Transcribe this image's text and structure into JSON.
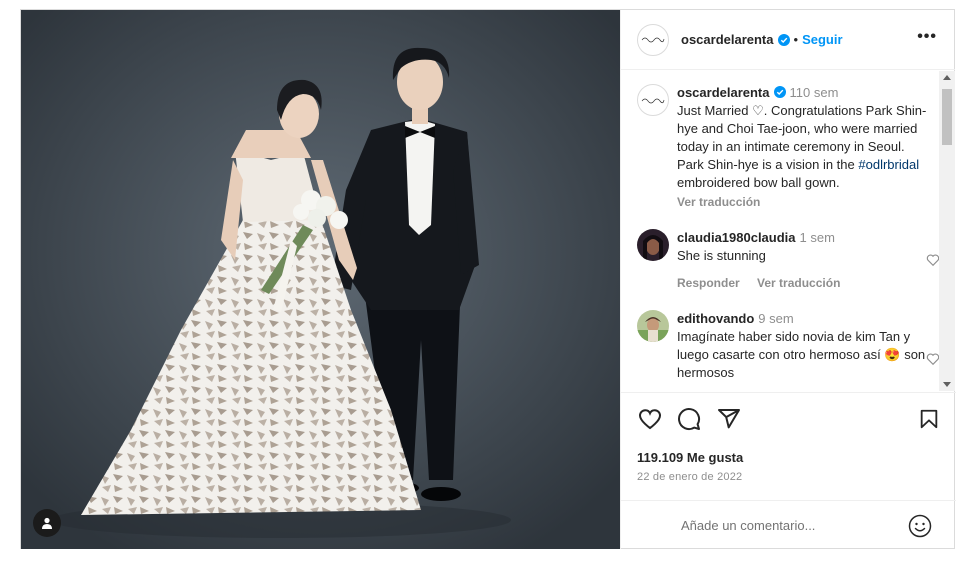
{
  "post": {
    "username": "oscardelarenta",
    "verified": true,
    "follow_label": "Seguir",
    "separator": "•",
    "more_label": "•••",
    "logo_text": "Oscar de la Renta"
  },
  "caption": {
    "username": "oscardelarenta",
    "time": "110 sem",
    "text_before_hashtag": "Just Married ♡. Congratulations Park Shin-hye and Choi Tae-joon, who were married today in an intimate ceremony in Seoul. Park Shin-hye is a vision in the ",
    "hashtag": "#odlrbridal",
    "text_after_hashtag": " embroidered bow ball gown.",
    "translate_label": "Ver traducción"
  },
  "comments": [
    {
      "username": "claudia1980claudia",
      "time": "1 sem",
      "text": "She is stunning",
      "reply_label": "Responder",
      "translate_label": "Ver traducción"
    },
    {
      "username": "edithovando",
      "time": "9 sem",
      "text": "Imagínate haber sido novia de kim Tan y luego casarte con otro hermoso así 😍 son hermosos"
    }
  ],
  "stats": {
    "likes": "119.109 Me gusta",
    "date": "22 de enero de 2022"
  },
  "add_comment": {
    "placeholder": "Añade un comentario..."
  },
  "icons": {
    "like": "heart-icon",
    "comment": "comment-icon",
    "share": "share-icon",
    "save": "bookmark-icon",
    "emoji": "emoji-icon",
    "user_tag": "user-tag-icon",
    "verified": "verified-badge-icon"
  },
  "colors": {
    "accent": "#0095f6",
    "verified": "#0095f6",
    "text": "#262626",
    "muted": "#8e8e8e",
    "hashtag": "#00376b"
  }
}
